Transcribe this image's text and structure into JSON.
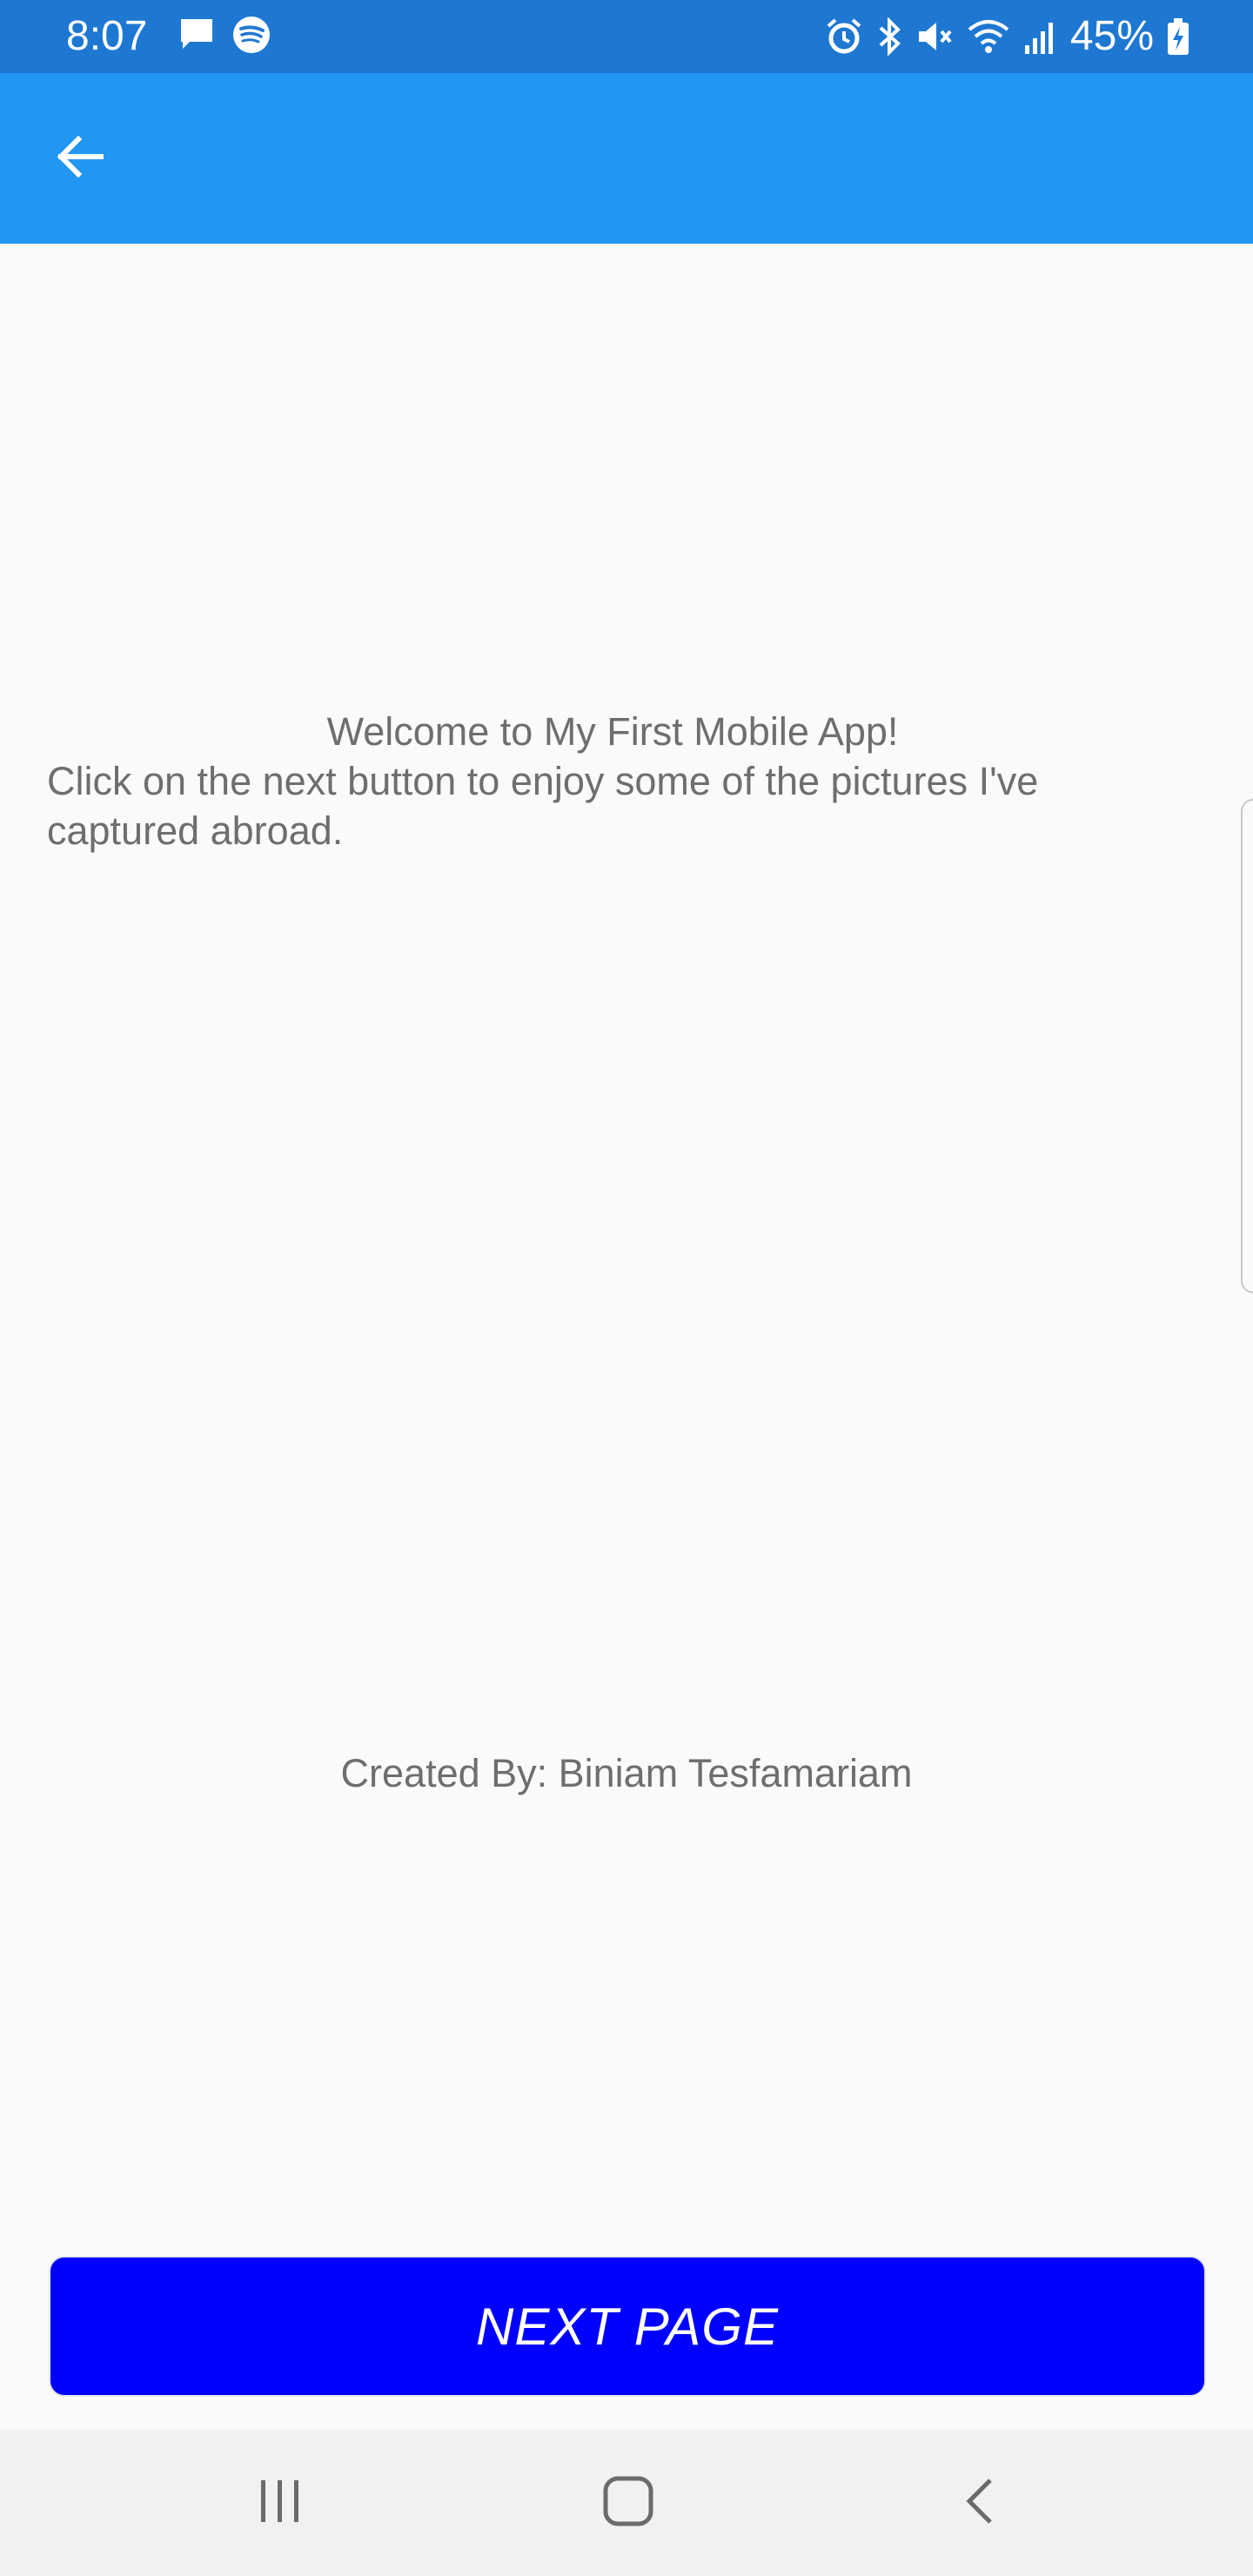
{
  "status_bar": {
    "time": "8:07",
    "battery": "45%",
    "left_icons": [
      "message-icon",
      "spotify-icon"
    ],
    "right_icons": [
      "alarm-icon",
      "bluetooth-icon",
      "mute-icon",
      "wifi-icon",
      "signal-icon",
      "battery-charging-icon"
    ],
    "background": "#1e78d2"
  },
  "app_bar": {
    "back_icon": "arrow-left-icon",
    "background": "#2196f3"
  },
  "content": {
    "welcome_title": "Welcome to My First Mobile App!",
    "welcome_body": "Click on the next button to enjoy some of the pictures I've captured abroad.",
    "credit": "Created By: Biniam Tesfamariam"
  },
  "next_button": {
    "label": "NEXT PAGE",
    "color": "#0000ff"
  },
  "nav_bar": {
    "items": [
      "recent-apps-icon",
      "home-icon",
      "back-icon"
    ]
  }
}
